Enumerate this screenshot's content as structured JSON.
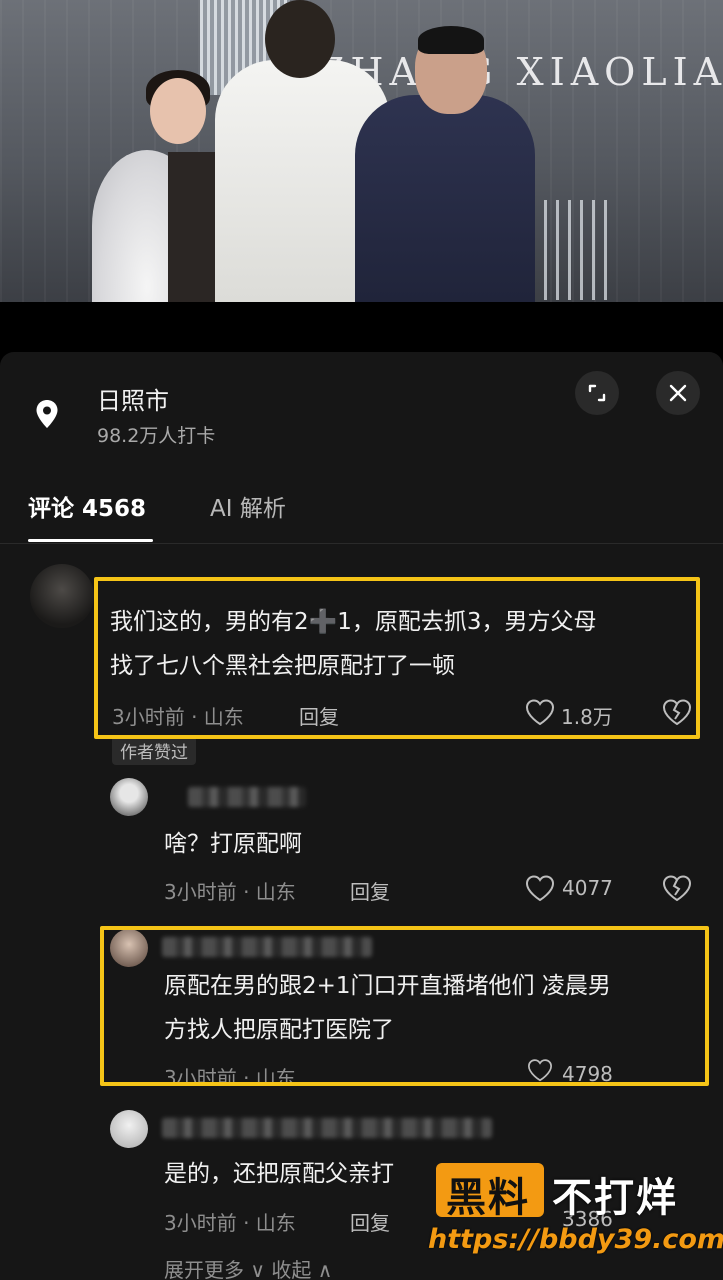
{
  "video": {
    "backdrop_text": "ZHANG XIAOLIANG SO"
  },
  "location": {
    "title": "日照市",
    "subtitle": "98.2万人打卡"
  },
  "tabs": [
    {
      "label": "评论 4568"
    },
    {
      "label": "AI 解析"
    }
  ],
  "comments": [
    {
      "text_line1": "我们这的，男的有2➕1，原配去抓3，男方父母",
      "text_line2": "找了七八个黑社会把原配打了一顿",
      "meta": "3小时前 · 山东",
      "reply_label": "回复",
      "likes": "1.8万",
      "badge": "作者赞过"
    },
    {
      "text": "啥？打原配啊",
      "meta": "3小时前 · 山东",
      "reply_label": "回复",
      "likes": "4077"
    },
    {
      "text_line1": "原配在男的跟2+1门口开直播堵他们 凌晨男",
      "text_line2": "方找人把原配打医院了",
      "meta": "3小时前 · 山东",
      "likes": "4798"
    },
    {
      "text": "是的，还把原配父亲打",
      "meta": "3小时前 · 山东",
      "reply_label": "回复",
      "likes": "3386"
    }
  ],
  "expand_more": "展开更多  ∨     收起  ∧",
  "watermark": {
    "black": "黑料",
    "white": "不打烊",
    "url": "https://bbdy39.com"
  },
  "colors": {
    "highlight": "#f5c417",
    "watermark_orange": "#f39a12",
    "panel_bg": "#161616"
  }
}
